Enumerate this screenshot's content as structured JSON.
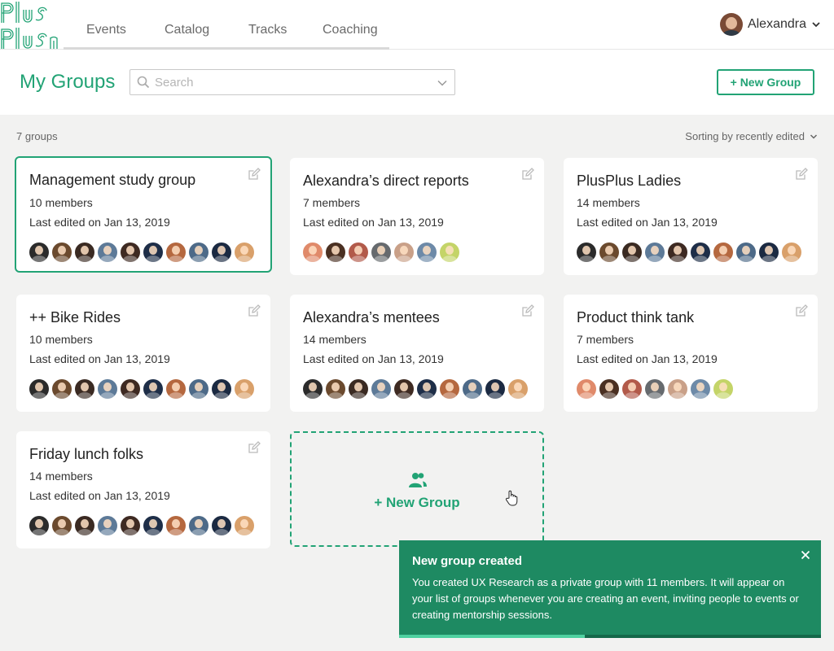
{
  "app": {
    "logo_text": "Plus Plus",
    "accent_color": "#22a375",
    "toast_color": "#1e8a62"
  },
  "nav": {
    "tabs": [
      {
        "label": "Events"
      },
      {
        "label": "Catalog"
      },
      {
        "label": "Tracks"
      },
      {
        "label": "Coaching"
      }
    ]
  },
  "user": {
    "name": "Alexandra"
  },
  "header": {
    "title": "My Groups",
    "search_placeholder": "Search",
    "new_group_label": "+ New Group"
  },
  "meta": {
    "count": "7 groups",
    "sort_label": "Sorting by recently edited"
  },
  "groups": [
    {
      "name": "Management study group",
      "members": "10 members",
      "edited": "Last edited on Jan 13, 2019",
      "selected": true,
      "avatars": [
        "#2b2b2b",
        "#6b4a2e",
        "#3a2a22",
        "#5d7a98",
        "#3e2a22",
        "#1e2e48",
        "#b5683f",
        "#4d6a88",
        "#1b2a42",
        "#d9a06a"
      ]
    },
    {
      "name": "Alexandra’s direct reports",
      "members": "7 members",
      "edited": "Last edited on Jan 13, 2019",
      "selected": false,
      "avatars": [
        "#e08a6a",
        "#4a3022",
        "#b25a4a",
        "#666a6e",
        "#c9a088",
        "#6d8aa8",
        "#c4d468"
      ]
    },
    {
      "name": "PlusPlus Ladies",
      "members": "14 members",
      "edited": "Last edited on Jan 13, 2019",
      "selected": false,
      "avatars": [
        "#2b2b2b",
        "#6b4a2e",
        "#3a2a22",
        "#5d7a98",
        "#3e2a22",
        "#1e2e48",
        "#b5683f",
        "#4d6a88",
        "#1b2a42",
        "#d9a06a"
      ]
    },
    {
      "name": "++ Bike Rides",
      "members": "10 members",
      "edited": "Last edited on Jan 13, 2019",
      "selected": false,
      "avatars": [
        "#2b2b2b",
        "#6b4a2e",
        "#3a2a22",
        "#5d7a98",
        "#3e2a22",
        "#1e2e48",
        "#b5683f",
        "#4d6a88",
        "#1b2a42",
        "#d9a06a"
      ]
    },
    {
      "name": "Alexandra’s mentees",
      "members": "14 members",
      "edited": "Last edited on Jan 13, 2019",
      "selected": false,
      "avatars": [
        "#2b2b2b",
        "#6b4a2e",
        "#3a2a22",
        "#5d7a98",
        "#3e2a22",
        "#1e2e48",
        "#b5683f",
        "#4d6a88",
        "#1b2a42",
        "#d9a06a"
      ]
    },
    {
      "name": "Product think tank",
      "members": "7 members",
      "edited": "Last edited on Jan 13, 2019",
      "selected": false,
      "avatars": [
        "#e08a6a",
        "#4a3022",
        "#b25a4a",
        "#666a6e",
        "#c9a088",
        "#6d8aa8",
        "#c4d468"
      ]
    },
    {
      "name": "Friday lunch folks",
      "members": "14 members",
      "edited": "Last edited on Jan 13, 2019",
      "selected": false,
      "avatars": [
        "#2b2b2b",
        "#6b4a2e",
        "#3a2a22",
        "#5d7a98",
        "#3e2a22",
        "#1e2e48",
        "#b5683f",
        "#4d6a88",
        "#1b2a42",
        "#d9a06a"
      ]
    }
  ],
  "new_group_card": {
    "label": "+ New Group"
  },
  "toast": {
    "title": "New group created",
    "message": "You created UX Research as a private group with 11 members. It will appear on your list of groups whenever you are creating an event, inviting people to events or creating mentorship sessions.",
    "progress": 0.44
  }
}
